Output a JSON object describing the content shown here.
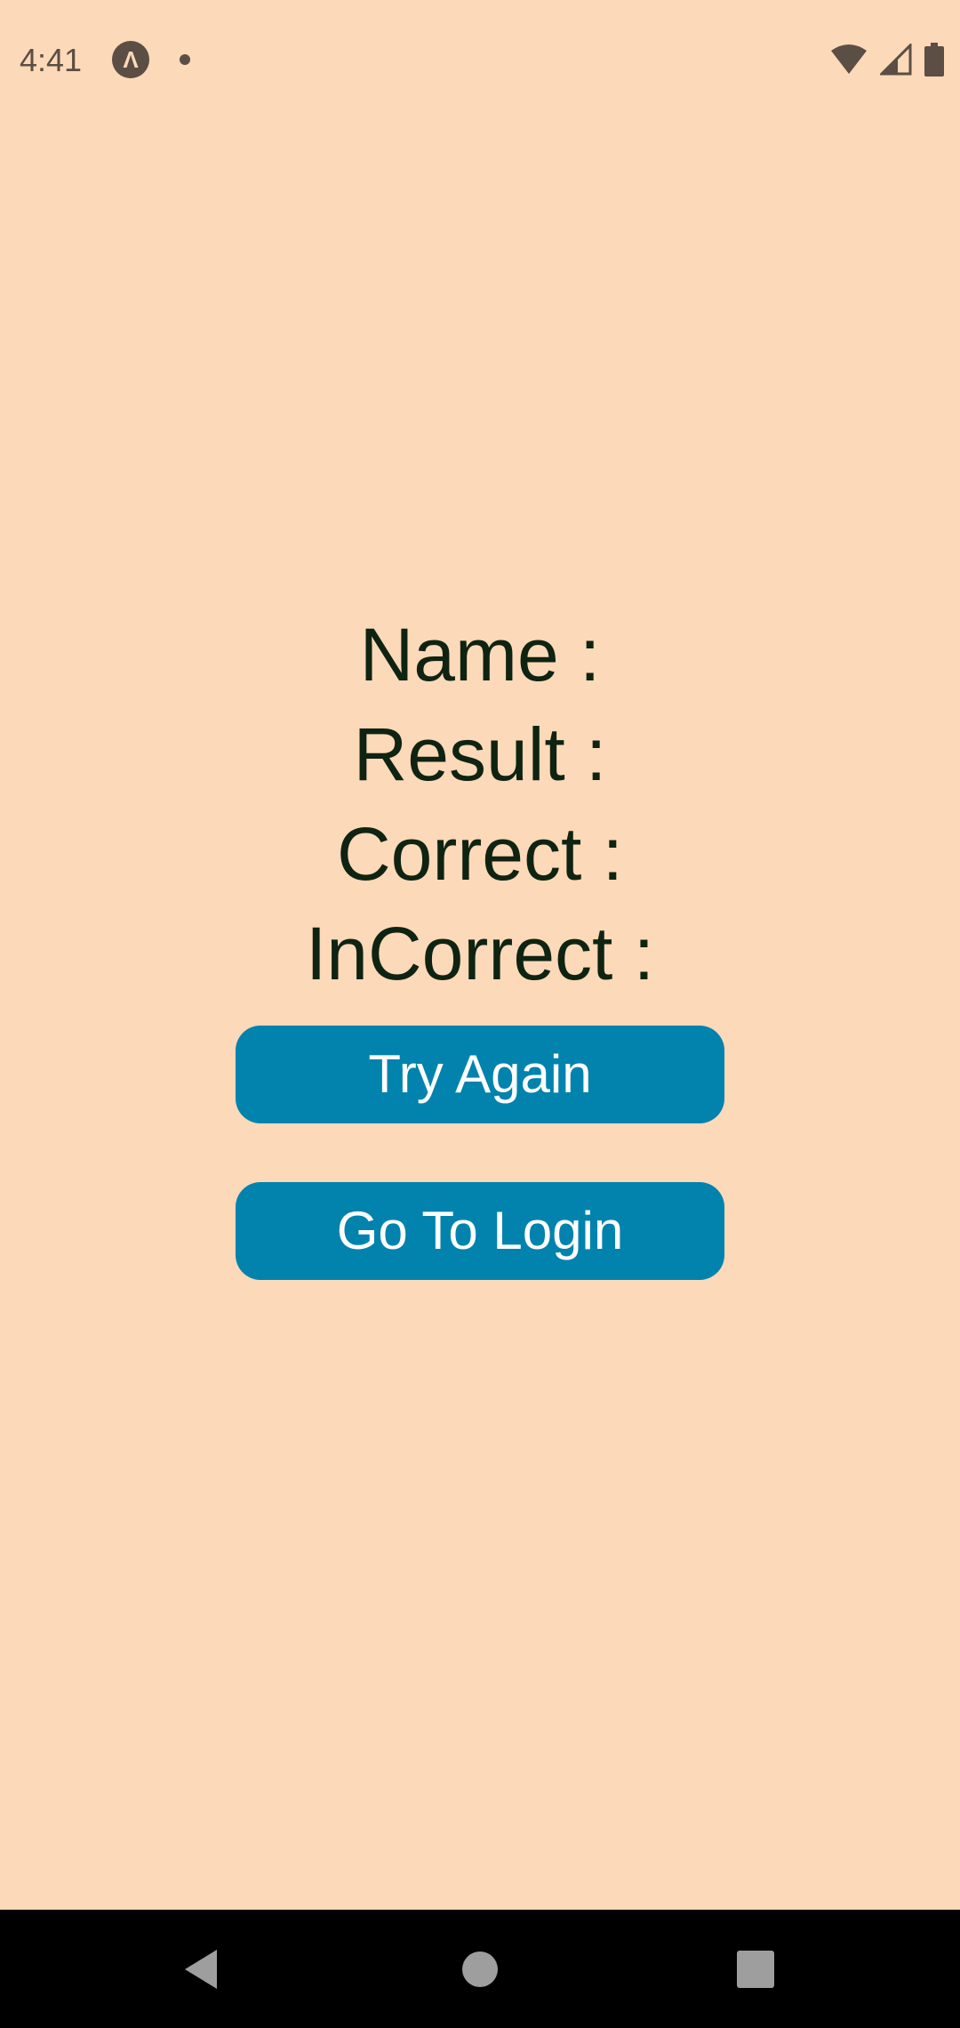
{
  "status_bar": {
    "time": "4:41",
    "app_badge_glyph": "Λ",
    "icons": [
      "wifi-icon",
      "signal-icon",
      "battery-icon"
    ]
  },
  "result": {
    "name_label": "Name :",
    "result_label": "Result :",
    "correct_label": "Correct :",
    "incorrect_label": "InCorrect :"
  },
  "buttons": {
    "try_again": "Try Again",
    "go_to_login": "Go To Login"
  },
  "nav_bar": {
    "icons": [
      "back-icon",
      "home-icon",
      "recents-icon"
    ]
  },
  "colors": {
    "background": "#FCD9B8",
    "text": "#0F2312",
    "button": "#0283AD",
    "button_text": "#FFFFFF",
    "status_icons": "#5A4E45",
    "nav_bar": "#000000"
  }
}
